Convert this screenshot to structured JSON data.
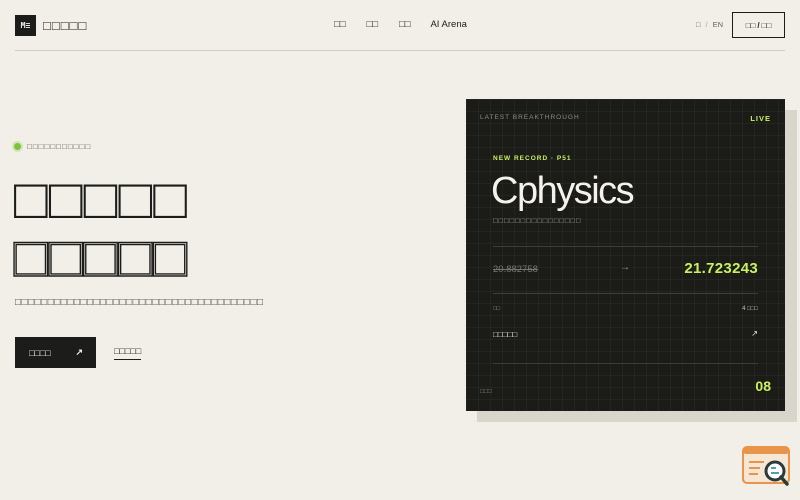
{
  "header": {
    "logo_mark": "M≡",
    "logo_text": "□□□□□",
    "nav": [
      "□□",
      "□□",
      "□□",
      "AI Arena"
    ],
    "lang": {
      "current": "□",
      "separator": "/",
      "other": "EN"
    },
    "cta": {
      "left": "□□",
      "separator": "/",
      "right": "□□"
    }
  },
  "hero": {
    "status_text": "□□□□□□□□□□□",
    "title_line1": "□□□□□",
    "title_line2": "□□□□□",
    "description": "□□□□□□□□□□□□□□□□□□□□□□□□□□□□□□□□□□□□□□",
    "primary_button": {
      "label": "□□□□",
      "arrow": "↗"
    },
    "secondary_link": "□□□□□"
  },
  "card": {
    "eyebrow": "LATEST BREAKTHROUGH",
    "live": "LIVE",
    "tag": "NEW RECORD · P51",
    "title": "Cphysics",
    "subtitle": "□□□□□□□□□□□□□□□□",
    "old_value": "20.882758",
    "arrow": "→",
    "new_value": "21.723243",
    "meta_label": "□□",
    "meta_count": "4 □□□",
    "link_label": "□□□□□",
    "link_arrow": "↗",
    "footer_label": "□□□",
    "footer_number": "08"
  },
  "colors": {
    "background": "#f1efe7",
    "ink": "#1c1d1a",
    "accent": "#c8f060",
    "status_dot": "#7ec43a",
    "card_bg": "#1b1c18"
  },
  "icons": {
    "widget": "search-magnifier-icon"
  }
}
